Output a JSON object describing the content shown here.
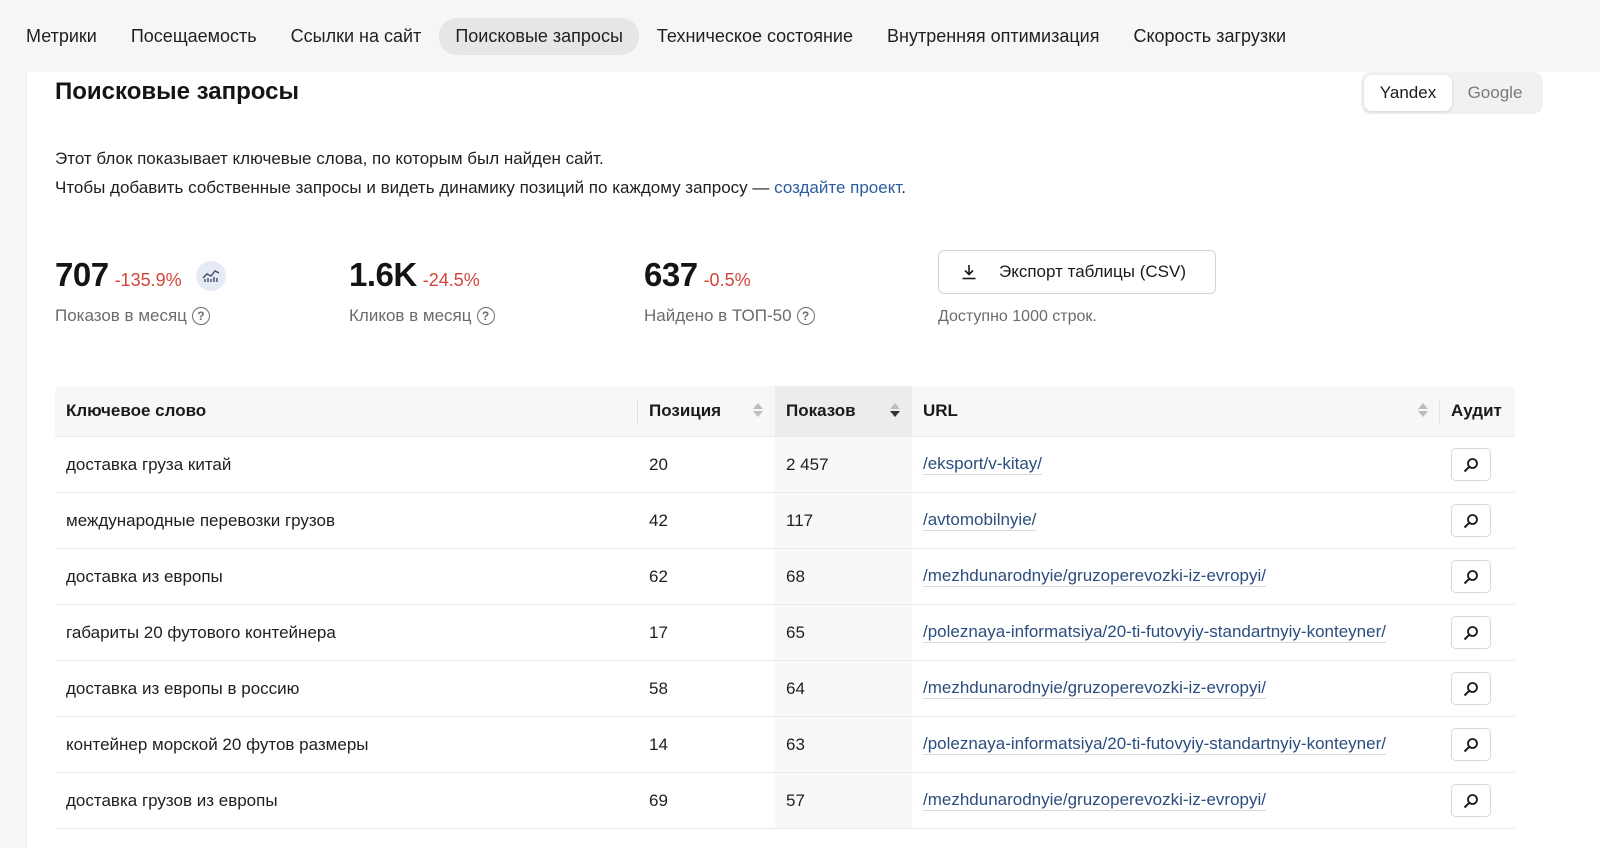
{
  "nav": {
    "items": [
      {
        "label": "Метрики",
        "active": false
      },
      {
        "label": "Посещаемость",
        "active": false
      },
      {
        "label": "Ссылки на сайт",
        "active": false
      },
      {
        "label": "Поисковые запросы",
        "active": true
      },
      {
        "label": "Техническое состояние",
        "active": false
      },
      {
        "label": "Внутренняя оптимизация",
        "active": false
      },
      {
        "label": "Скорость загрузки",
        "active": false
      }
    ]
  },
  "section": {
    "title": "Поисковые запросы",
    "engines": {
      "yandex": "Yandex",
      "google": "Google",
      "selected": "Yandex"
    },
    "desc_line1": "Этот блок показывает ключевые слова, по которым был найден сайт.",
    "desc_line2": "Чтобы добавить собственные запросы и видеть динамику позиций по каждому запросу —",
    "desc_link": "создайте проект",
    "desc_end": "."
  },
  "stats": {
    "impressions": {
      "value": "707",
      "delta": "-135.9%",
      "label": "Показов в месяц"
    },
    "clicks": {
      "value": "1.6K",
      "delta": "-24.5%",
      "label": "Кликов в месяц"
    },
    "top50": {
      "value": "637",
      "delta": "-0.5%",
      "label": "Найдено в ТОП-50"
    }
  },
  "export": {
    "label": "Экспорт таблицы (CSV)",
    "note": "Доступно 1000 строк."
  },
  "table": {
    "headers": {
      "keyword": "Ключевое слово",
      "position": "Позиция",
      "impressions": "Показов",
      "url": "URL",
      "audit": "Аудит"
    },
    "rows": [
      {
        "keyword": "доставка груза китай",
        "position": "20",
        "impressions": "2 457",
        "url": "/eksport/v-kitay/"
      },
      {
        "keyword": "международные перевозки грузов",
        "position": "42",
        "impressions": "117",
        "url": "/avtomobilnyie/"
      },
      {
        "keyword": "доставка из европы",
        "position": "62",
        "impressions": "68",
        "url": "/mezhdunarodnyie/gruzoperevozki-iz-evropyi/"
      },
      {
        "keyword": "габариты 20 футового контейнера",
        "position": "17",
        "impressions": "65",
        "url": "/poleznaya-informatsiya/20-ti-futovyiy-standartnyiy-konteyner/"
      },
      {
        "keyword": "доставка из европы в россию",
        "position": "58",
        "impressions": "64",
        "url": "/mezhdunarodnyie/gruzoperevozki-iz-evropyi/"
      },
      {
        "keyword": "контейнер морской 20 футов размеры",
        "position": "14",
        "impressions": "63",
        "url": "/poleznaya-informatsiya/20-ti-futovyiy-standartnyiy-konteyner/"
      },
      {
        "keyword": "доставка грузов из европы",
        "position": "69",
        "impressions": "57",
        "url": "/mezhdunarodnyie/gruzoperevozki-iz-evropyi/"
      }
    ]
  },
  "colors": {
    "accent_link": "#2b5d9c",
    "negative": "#d2453a"
  }
}
